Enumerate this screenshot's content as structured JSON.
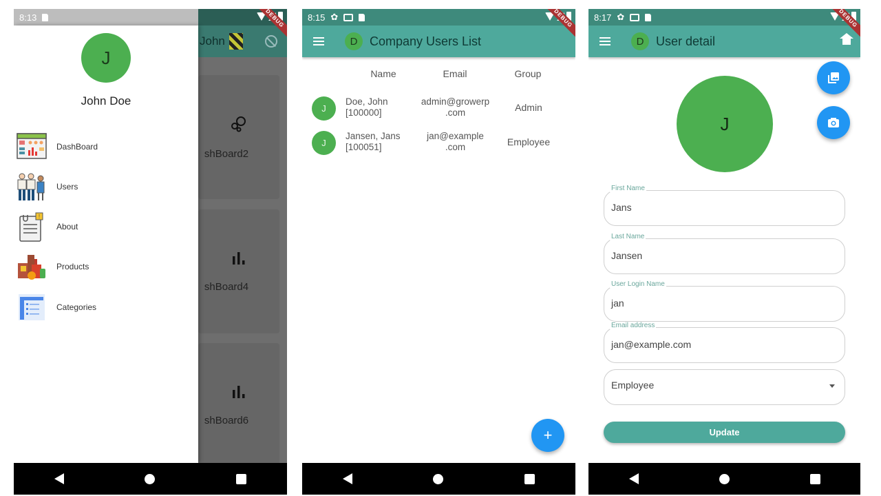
{
  "colors": {
    "appbar": "#4ea99c",
    "statusbar": "#3e8a7c",
    "avatar_green": "#4caf50",
    "fab_blue": "#2196f3",
    "debug_banner": "#aa3333"
  },
  "screens": [
    {
      "name": "navigation-drawer",
      "status_time": "8:13",
      "debug_label": "DEBUG",
      "background": {
        "appbar_title": "John",
        "cards": [
          {
            "label": "shBoard2",
            "icon": "bubble-chart-icon"
          },
          {
            "label": "shBoard4",
            "icon": "bar-chart-icon"
          },
          {
            "label": "shBoard6",
            "icon": "bar-chart-icon"
          }
        ]
      },
      "drawer": {
        "avatar_initial": "J",
        "user_name": "John Doe",
        "items": [
          {
            "label": "DashBoard",
            "icon": "dashboard-icon"
          },
          {
            "label": "Users",
            "icon": "users-icon"
          },
          {
            "label": "About",
            "icon": "about-icon"
          },
          {
            "label": "Products",
            "icon": "products-icon"
          },
          {
            "label": "Categories",
            "icon": "categories-icon"
          }
        ]
      }
    },
    {
      "name": "company-users-list",
      "status_time": "8:15",
      "debug_label": "DEBUG",
      "appbar": {
        "avatar_initial": "D",
        "title": "Company Users List"
      },
      "table": {
        "headers": [
          "Name",
          "Email",
          "Group"
        ],
        "rows": [
          {
            "avatar": "J",
            "name": "Doe, John",
            "id": "[100000]",
            "email_1": "admin@growerp",
            "email_2": ".com",
            "group": "Admin"
          },
          {
            "avatar": "J",
            "name": "Jansen, Jans",
            "id": "[100051]",
            "email_1": "jan@example",
            "email_2": ".com",
            "group": "Employee"
          }
        ]
      },
      "fab_label": "+"
    },
    {
      "name": "user-detail",
      "status_time": "8:17",
      "debug_label": "DEBUG",
      "appbar": {
        "avatar_initial": "D",
        "title": "User detail"
      },
      "avatar_initial": "J",
      "fields": [
        {
          "label": "First Name",
          "value": "Jans"
        },
        {
          "label": "Last Name",
          "value": "Jansen"
        },
        {
          "label": "User Login Name",
          "value": "jan"
        },
        {
          "label": "Email address",
          "value": "jan@example.com"
        }
      ],
      "group_select": {
        "value": "Employee"
      },
      "update_label": "Update"
    }
  ]
}
